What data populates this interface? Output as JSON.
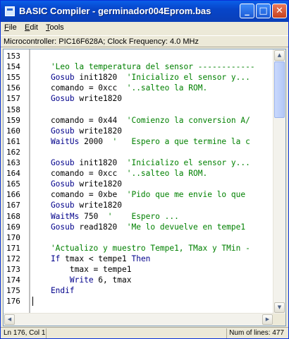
{
  "window": {
    "title": "BASIC Compiler - germinador004Eprom.bas",
    "buttons": {
      "minimize": "_",
      "maximize": "□",
      "close": "✕"
    }
  },
  "menu": [
    "File",
    "Edit",
    "Tools"
  ],
  "info": "Microcontroller: PIC16F628A;  Clock Frequency: 4.0 MHz",
  "editor": {
    "lines": [
      {
        "n": "153",
        "parts": []
      },
      {
        "n": "154",
        "parts": [
          {
            "t": "cm",
            "v": "    'Leo la temperatura del sensor ------------"
          }
        ]
      },
      {
        "n": "155",
        "parts": [
          {
            "t": "kw",
            "v": "    Gosub"
          },
          {
            "t": "tx",
            "v": " init1820  "
          },
          {
            "t": "cm",
            "v": "'Inicializo el sensor y..."
          }
        ]
      },
      {
        "n": "156",
        "parts": [
          {
            "t": "tx",
            "v": "    comando = 0xcc  "
          },
          {
            "t": "cm",
            "v": "'..salteo la ROM."
          }
        ]
      },
      {
        "n": "157",
        "parts": [
          {
            "t": "kw",
            "v": "    Gosub"
          },
          {
            "t": "tx",
            "v": " write1820"
          }
        ]
      },
      {
        "n": "158",
        "parts": []
      },
      {
        "n": "159",
        "parts": [
          {
            "t": "tx",
            "v": "    comando = 0x44  "
          },
          {
            "t": "cm",
            "v": "'Comienzo la conversion A/"
          }
        ]
      },
      {
        "n": "160",
        "parts": [
          {
            "t": "kw",
            "v": "    Gosub"
          },
          {
            "t": "tx",
            "v": " write1820"
          }
        ]
      },
      {
        "n": "161",
        "parts": [
          {
            "t": "kw",
            "v": "    WaitUs"
          },
          {
            "t": "tx",
            "v": " 2000  "
          },
          {
            "t": "cm",
            "v": "'   Espero a que termine la c"
          }
        ]
      },
      {
        "n": "162",
        "parts": []
      },
      {
        "n": "163",
        "parts": [
          {
            "t": "kw",
            "v": "    Gosub"
          },
          {
            "t": "tx",
            "v": " init1820  "
          },
          {
            "t": "cm",
            "v": "'Inicializo el sensor y..."
          }
        ]
      },
      {
        "n": "164",
        "parts": [
          {
            "t": "tx",
            "v": "    comando = 0xcc  "
          },
          {
            "t": "cm",
            "v": "'..salteo la ROM."
          }
        ]
      },
      {
        "n": "165",
        "parts": [
          {
            "t": "kw",
            "v": "    Gosub"
          },
          {
            "t": "tx",
            "v": " write1820"
          }
        ]
      },
      {
        "n": "166",
        "parts": [
          {
            "t": "tx",
            "v": "    comando = 0xbe  "
          },
          {
            "t": "cm",
            "v": "'Pido que me envie lo que"
          }
        ]
      },
      {
        "n": "167",
        "parts": [
          {
            "t": "kw",
            "v": "    Gosub"
          },
          {
            "t": "tx",
            "v": " write1820"
          }
        ]
      },
      {
        "n": "168",
        "parts": [
          {
            "t": "kw",
            "v": "    WaitMs"
          },
          {
            "t": "tx",
            "v": " 750  "
          },
          {
            "t": "cm",
            "v": "'    Espero ..."
          }
        ]
      },
      {
        "n": "169",
        "parts": [
          {
            "t": "kw",
            "v": "    Gosub"
          },
          {
            "t": "tx",
            "v": " read1820  "
          },
          {
            "t": "cm",
            "v": "'Me lo devuelve en tempe1"
          }
        ]
      },
      {
        "n": "170",
        "parts": []
      },
      {
        "n": "171",
        "parts": [
          {
            "t": "cm",
            "v": "    'Actualizo y muestro Tempe1, TMax y TMin -"
          }
        ]
      },
      {
        "n": "172",
        "parts": [
          {
            "t": "kw",
            "v": "    If"
          },
          {
            "t": "tx",
            "v": " tmax < tempe1 "
          },
          {
            "t": "kw",
            "v": "Then"
          }
        ]
      },
      {
        "n": "173",
        "parts": [
          {
            "t": "tx",
            "v": "        tmax = tempe1"
          }
        ]
      },
      {
        "n": "174",
        "parts": [
          {
            "t": "kw",
            "v": "        Write"
          },
          {
            "t": "tx",
            "v": " 6, tmax"
          }
        ]
      },
      {
        "n": "175",
        "parts": [
          {
            "t": "kw",
            "v": "    Endif"
          }
        ]
      },
      {
        "n": "176",
        "parts": []
      }
    ]
  },
  "status": {
    "position": "Ln 176, Col 1",
    "lines": "Num of lines: 477"
  },
  "colors": {
    "keyword": "#00008b",
    "comment": "#008000",
    "title_bar": "#0a5ee8"
  }
}
